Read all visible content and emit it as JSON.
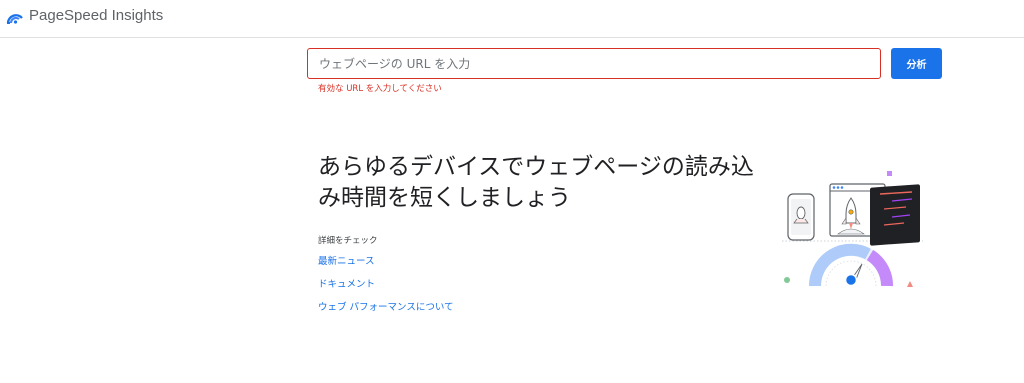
{
  "header": {
    "app_title": "PageSpeed Insights",
    "logo_icon": "pagespeed-gauge-icon"
  },
  "search": {
    "placeholder": "ウェブページの URL を入力",
    "value": "",
    "error": "有効な URL を入力してください",
    "analyze_label": "分析"
  },
  "hero": {
    "headline": "あらゆるデバイスでウェブページの読み込み時間を短くしましょう",
    "details_label": "詳細をチェック",
    "links": [
      "最新ニュース",
      "ドキュメント",
      "ウェブ パフォーマンスについて"
    ]
  },
  "colors": {
    "accent": "#1a73e8",
    "error": "#d93025",
    "divider": "#e0e0e0"
  },
  "illustration": {
    "icons": [
      "phone-icon",
      "browser-window-icon",
      "rocket-icon",
      "code-window-icon",
      "speed-gauge-icon"
    ]
  }
}
